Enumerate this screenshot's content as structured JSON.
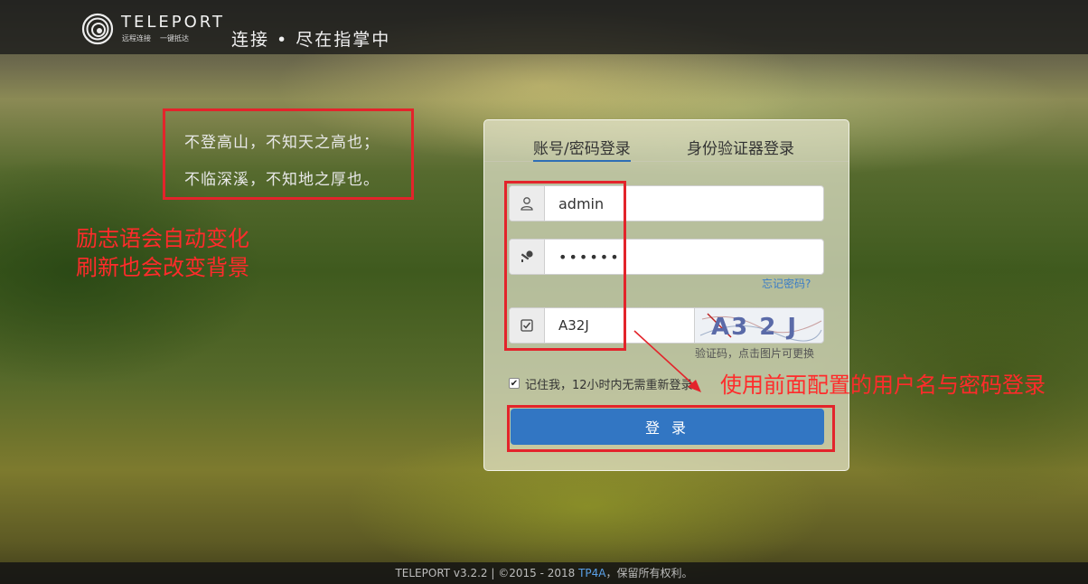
{
  "header": {
    "logo_title": "TELEPORT",
    "logo_sub_left": "远程连接",
    "logo_sub_right": "一键抵达",
    "slogan": "连接 • 尽在指掌中"
  },
  "quote": {
    "line1": "不登高山，不知天之高也；",
    "line2": "不临深溪，不知地之厚也。"
  },
  "annotations": {
    "note_line1": "励志语会自动变化",
    "note_line2": "刷新也会改变背景",
    "note_login": "使用前面配置的用户名与密码登录",
    "color": "#e3242b"
  },
  "login": {
    "tab_password": "账号/密码登录",
    "tab_authenticator": "身份验证器登录",
    "active_tab": "账号/密码登录",
    "username_value": "admin",
    "password_value": "••••••",
    "forgot_label": "忘记密码?",
    "captcha_value": "A32J",
    "captcha_image_text": "A3 2 J",
    "captcha_hint": "验证码，点击图片可更换",
    "remember_label": "记住我，12小时内无需重新登录。",
    "remember_checked": "✔",
    "submit_label": "登 录",
    "accent_color": "#3276c3"
  },
  "footer": {
    "prefix": "TELEPORT v3.2.2 | ©2015 - 2018 ",
    "link": "TP4A",
    "suffix": "，保留所有权利。"
  },
  "icons": [
    "logo-spiral-icon",
    "user-icon",
    "key-icon",
    "check-square-icon"
  ]
}
